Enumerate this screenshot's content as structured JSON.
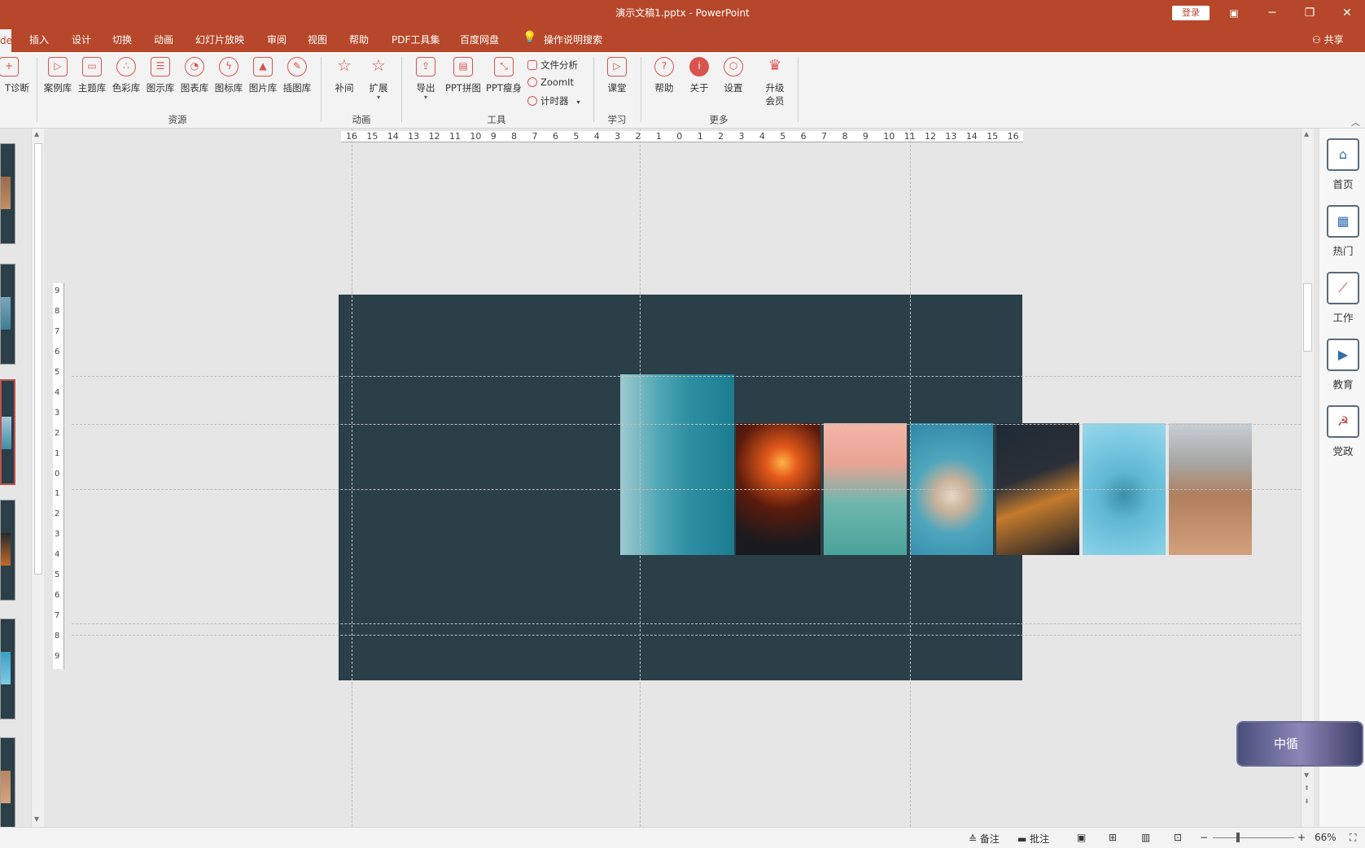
{
  "titlebar": {
    "title": "演示文稿1.pptx  -  PowerPoint",
    "login": "登录",
    "ribbon_display_icon": "ribbon-display-icon",
    "minimize": "─",
    "restore": "❐",
    "close": "✕"
  },
  "tabs": {
    "active_partial": "de",
    "items": [
      "插入",
      "设计",
      "切换",
      "动画",
      "幻灯片放映",
      "审阅",
      "视图",
      "帮助",
      "PDF工具集",
      "百度网盘"
    ],
    "tell_me": "操作说明搜索",
    "share": "共享"
  },
  "ribbon": {
    "partial_first": "T诊断",
    "resources": [
      "案例库",
      "主题库",
      "色彩库",
      "图示库",
      "图表库",
      "图标库",
      "图片库",
      "插图库"
    ],
    "animation": [
      "补间",
      "扩展"
    ],
    "tools_large": [
      "导出",
      "PPT拼图",
      "PPT瘦身"
    ],
    "tools_small": [
      "文件分析",
      "ZoomIt",
      "计时器"
    ],
    "learn": [
      "课堂"
    ],
    "more": [
      "帮助",
      "关于",
      "设置"
    ],
    "upgrade": [
      "升级",
      "会员"
    ],
    "groups": {
      "resources": "资源",
      "animation": "动画",
      "tools": "工具",
      "learn": "学习",
      "more": "更多"
    }
  },
  "ruler": {
    "h_ticks": [
      "16",
      "15",
      "14",
      "13",
      "12",
      "11",
      "10",
      "9",
      "8",
      "7",
      "6",
      "5",
      "4",
      "3",
      "2",
      "1",
      "0",
      "1",
      "2",
      "3",
      "4",
      "5",
      "6",
      "7",
      "8",
      "9",
      "10",
      "11",
      "12",
      "13",
      "14",
      "15",
      "16"
    ],
    "v_ticks": [
      "9",
      "8",
      "7",
      "6",
      "5",
      "4",
      "3",
      "2",
      "1",
      "0",
      "1",
      "2",
      "3",
      "4",
      "5",
      "6",
      "7",
      "8",
      "9"
    ]
  },
  "side_panel": {
    "items": [
      "首页",
      "热门",
      "工作",
      "教育",
      "党政"
    ]
  },
  "badge": {
    "text": "中循"
  },
  "statusbar": {
    "notes": "备注",
    "comments": "批注",
    "zoom_minus": "−",
    "zoom_plus": "+",
    "zoom": "66%"
  },
  "colors": {
    "brand": "#b7472a",
    "slide_bg": "#2a3f47",
    "accent_icon": "#d9534f"
  }
}
